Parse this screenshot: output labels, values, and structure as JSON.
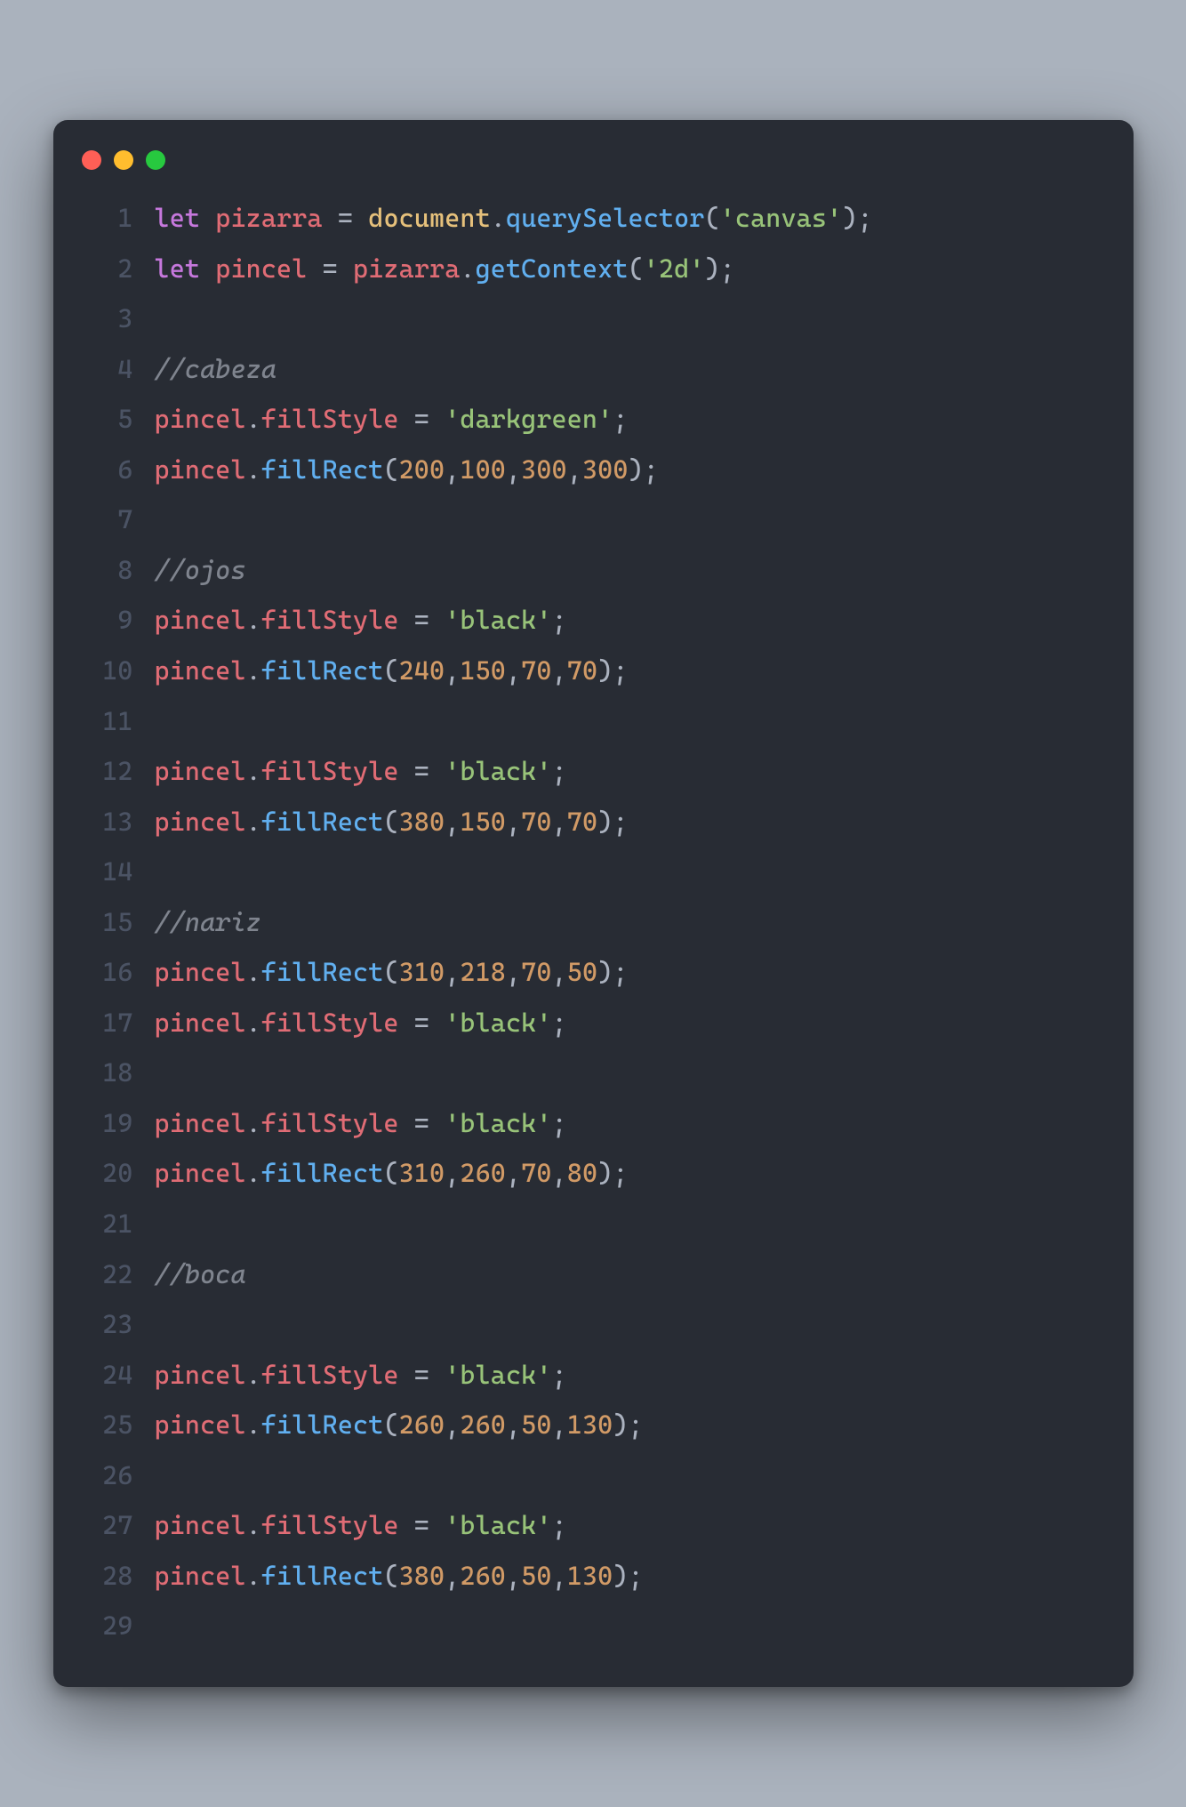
{
  "window": {
    "traffic_lights": [
      "close",
      "minimize",
      "zoom"
    ]
  },
  "code": {
    "lines": [
      {
        "n": "1",
        "tokens": [
          [
            "kw",
            "let"
          ],
          [
            "sp",
            " "
          ],
          [
            "var",
            "pizarra"
          ],
          [
            "sp",
            " "
          ],
          [
            "op",
            "="
          ],
          [
            "sp",
            " "
          ],
          [
            "id",
            "document"
          ],
          [
            "pn",
            "."
          ],
          [
            "fn",
            "querySelector"
          ],
          [
            "pn",
            "("
          ],
          [
            "str",
            "'canvas'"
          ],
          [
            "pn",
            ")"
          ],
          [
            "pn",
            ";"
          ]
        ]
      },
      {
        "n": "2",
        "tokens": [
          [
            "kw",
            "let"
          ],
          [
            "sp",
            " "
          ],
          [
            "var",
            "pincel"
          ],
          [
            "sp",
            " "
          ],
          [
            "op",
            "="
          ],
          [
            "sp",
            " "
          ],
          [
            "var",
            "pizarra"
          ],
          [
            "pn",
            "."
          ],
          [
            "fn",
            "getContext"
          ],
          [
            "pn",
            "("
          ],
          [
            "str",
            "'2d'"
          ],
          [
            "pn",
            ")"
          ],
          [
            "pn",
            ";"
          ]
        ]
      },
      {
        "n": "3",
        "tokens": []
      },
      {
        "n": "4",
        "tokens": [
          [
            "cm",
            "//cabeza"
          ]
        ]
      },
      {
        "n": "5",
        "tokens": [
          [
            "var",
            "pincel"
          ],
          [
            "pn",
            "."
          ],
          [
            "prop",
            "fillStyle"
          ],
          [
            "sp",
            " "
          ],
          [
            "op",
            "="
          ],
          [
            "sp",
            " "
          ],
          [
            "str",
            "'darkgreen'"
          ],
          [
            "pn",
            ";"
          ]
        ]
      },
      {
        "n": "6",
        "tokens": [
          [
            "var",
            "pincel"
          ],
          [
            "pn",
            "."
          ],
          [
            "fn",
            "fillRect"
          ],
          [
            "pn",
            "("
          ],
          [
            "num",
            "200"
          ],
          [
            "pn",
            ","
          ],
          [
            "num",
            "100"
          ],
          [
            "pn",
            ","
          ],
          [
            "num",
            "300"
          ],
          [
            "pn",
            ","
          ],
          [
            "num",
            "300"
          ],
          [
            "pn",
            ")"
          ],
          [
            "pn",
            ";"
          ]
        ]
      },
      {
        "n": "7",
        "tokens": []
      },
      {
        "n": "8",
        "tokens": [
          [
            "cm",
            "//ojos"
          ]
        ]
      },
      {
        "n": "9",
        "tokens": [
          [
            "var",
            "pincel"
          ],
          [
            "pn",
            "."
          ],
          [
            "prop",
            "fillStyle"
          ],
          [
            "sp",
            " "
          ],
          [
            "op",
            "="
          ],
          [
            "sp",
            " "
          ],
          [
            "str",
            "'black'"
          ],
          [
            "pn",
            ";"
          ]
        ]
      },
      {
        "n": "10",
        "tokens": [
          [
            "var",
            "pincel"
          ],
          [
            "pn",
            "."
          ],
          [
            "fn",
            "fillRect"
          ],
          [
            "pn",
            "("
          ],
          [
            "num",
            "240"
          ],
          [
            "pn",
            ","
          ],
          [
            "num",
            "150"
          ],
          [
            "pn",
            ","
          ],
          [
            "num",
            "70"
          ],
          [
            "pn",
            ","
          ],
          [
            "num",
            "70"
          ],
          [
            "pn",
            ")"
          ],
          [
            "pn",
            ";"
          ]
        ]
      },
      {
        "n": "11",
        "tokens": []
      },
      {
        "n": "12",
        "tokens": [
          [
            "var",
            "pincel"
          ],
          [
            "pn",
            "."
          ],
          [
            "prop",
            "fillStyle"
          ],
          [
            "sp",
            " "
          ],
          [
            "op",
            "="
          ],
          [
            "sp",
            " "
          ],
          [
            "str",
            "'black'"
          ],
          [
            "pn",
            ";"
          ]
        ]
      },
      {
        "n": "13",
        "tokens": [
          [
            "var",
            "pincel"
          ],
          [
            "pn",
            "."
          ],
          [
            "fn",
            "fillRect"
          ],
          [
            "pn",
            "("
          ],
          [
            "num",
            "380"
          ],
          [
            "pn",
            ","
          ],
          [
            "num",
            "150"
          ],
          [
            "pn",
            ","
          ],
          [
            "num",
            "70"
          ],
          [
            "pn",
            ","
          ],
          [
            "num",
            "70"
          ],
          [
            "pn",
            ")"
          ],
          [
            "pn",
            ";"
          ]
        ]
      },
      {
        "n": "14",
        "tokens": []
      },
      {
        "n": "15",
        "tokens": [
          [
            "cm",
            "//nariz"
          ]
        ]
      },
      {
        "n": "16",
        "tokens": [
          [
            "var",
            "pincel"
          ],
          [
            "pn",
            "."
          ],
          [
            "fn",
            "fillRect"
          ],
          [
            "pn",
            "("
          ],
          [
            "num",
            "310"
          ],
          [
            "pn",
            ","
          ],
          [
            "num",
            "218"
          ],
          [
            "pn",
            ","
          ],
          [
            "num",
            "70"
          ],
          [
            "pn",
            ","
          ],
          [
            "num",
            "50"
          ],
          [
            "pn",
            ")"
          ],
          [
            "pn",
            ";"
          ]
        ]
      },
      {
        "n": "17",
        "tokens": [
          [
            "var",
            "pincel"
          ],
          [
            "pn",
            "."
          ],
          [
            "prop",
            "fillStyle"
          ],
          [
            "sp",
            " "
          ],
          [
            "op",
            "="
          ],
          [
            "sp",
            " "
          ],
          [
            "str",
            "'black'"
          ],
          [
            "pn",
            ";"
          ]
        ]
      },
      {
        "n": "18",
        "tokens": []
      },
      {
        "n": "19",
        "tokens": [
          [
            "var",
            "pincel"
          ],
          [
            "pn",
            "."
          ],
          [
            "prop",
            "fillStyle"
          ],
          [
            "sp",
            " "
          ],
          [
            "op",
            "="
          ],
          [
            "sp",
            " "
          ],
          [
            "str",
            "'black'"
          ],
          [
            "pn",
            ";"
          ]
        ]
      },
      {
        "n": "20",
        "tokens": [
          [
            "var",
            "pincel"
          ],
          [
            "pn",
            "."
          ],
          [
            "fn",
            "fillRect"
          ],
          [
            "pn",
            "("
          ],
          [
            "num",
            "310"
          ],
          [
            "pn",
            ","
          ],
          [
            "num",
            "260"
          ],
          [
            "pn",
            ","
          ],
          [
            "num",
            "70"
          ],
          [
            "pn",
            ","
          ],
          [
            "num",
            "80"
          ],
          [
            "pn",
            ")"
          ],
          [
            "pn",
            ";"
          ]
        ]
      },
      {
        "n": "21",
        "tokens": []
      },
      {
        "n": "22",
        "tokens": [
          [
            "cm",
            "//boca"
          ]
        ]
      },
      {
        "n": "23",
        "tokens": []
      },
      {
        "n": "24",
        "tokens": [
          [
            "var",
            "pincel"
          ],
          [
            "pn",
            "."
          ],
          [
            "prop",
            "fillStyle"
          ],
          [
            "sp",
            " "
          ],
          [
            "op",
            "="
          ],
          [
            "sp",
            " "
          ],
          [
            "str",
            "'black'"
          ],
          [
            "pn",
            ";"
          ]
        ]
      },
      {
        "n": "25",
        "tokens": [
          [
            "var",
            "pincel"
          ],
          [
            "pn",
            "."
          ],
          [
            "fn",
            "fillRect"
          ],
          [
            "pn",
            "("
          ],
          [
            "num",
            "260"
          ],
          [
            "pn",
            ","
          ],
          [
            "num",
            "260"
          ],
          [
            "pn",
            ","
          ],
          [
            "num",
            "50"
          ],
          [
            "pn",
            ","
          ],
          [
            "num",
            "130"
          ],
          [
            "pn",
            ")"
          ],
          [
            "pn",
            ";"
          ]
        ]
      },
      {
        "n": "26",
        "tokens": []
      },
      {
        "n": "27",
        "tokens": [
          [
            "var",
            "pincel"
          ],
          [
            "pn",
            "."
          ],
          [
            "prop",
            "fillStyle"
          ],
          [
            "sp",
            " "
          ],
          [
            "op",
            "="
          ],
          [
            "sp",
            " "
          ],
          [
            "str",
            "'black'"
          ],
          [
            "pn",
            ";"
          ]
        ]
      },
      {
        "n": "28",
        "tokens": [
          [
            "var",
            "pincel"
          ],
          [
            "pn",
            "."
          ],
          [
            "fn",
            "fillRect"
          ],
          [
            "pn",
            "("
          ],
          [
            "num",
            "380"
          ],
          [
            "pn",
            ","
          ],
          [
            "num",
            "260"
          ],
          [
            "pn",
            ","
          ],
          [
            "num",
            "50"
          ],
          [
            "pn",
            ","
          ],
          [
            "num",
            "130"
          ],
          [
            "pn",
            ")"
          ],
          [
            "pn",
            ";"
          ]
        ]
      },
      {
        "n": "29",
        "tokens": []
      }
    ]
  }
}
